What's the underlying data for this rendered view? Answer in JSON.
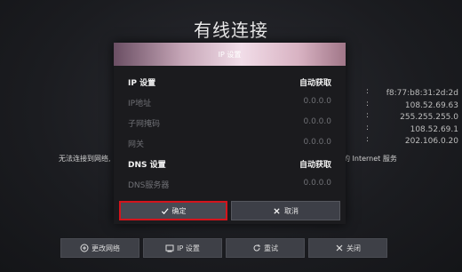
{
  "screen": {
    "title": "有线连接",
    "bg_values": [
      "f8:77:b8:31:2d:2d",
      "108.52.69.63",
      "255.255.255.0",
      "108.52.69.1",
      "202.106.0.20"
    ],
    "message_left": "无法连接到网络,",
    "message_right": "的 Internet 服务"
  },
  "bottom_buttons": [
    {
      "label": "更改网络",
      "icon": "network-change-icon"
    },
    {
      "label": "IP 设置",
      "icon": "ip-settings-icon"
    },
    {
      "label": "重试",
      "icon": "retry-icon"
    },
    {
      "label": "关闭",
      "icon": "close-icon"
    }
  ],
  "dialog": {
    "title": "IP 设置",
    "ip_settings_label": "IP 设置",
    "ip_settings_value": "自动获取",
    "ip_address_label": "IP地址",
    "ip_address_value": "0.0.0.0",
    "subnet_label": "子网掩码",
    "subnet_value": "0.0.0.0",
    "gateway_label": "网关",
    "gateway_value": "0.0.0.0",
    "dns_settings_label": "DNS 设置",
    "dns_settings_value": "自动获取",
    "dns_server_label": "DNS服务器",
    "dns_server_value": "0.0.0.0",
    "ok_label": "确定",
    "cancel_label": "取消"
  },
  "colors": {
    "focus_border": "#d4141c",
    "button_bg": "#3d3f47",
    "background": "#1b1c20"
  }
}
